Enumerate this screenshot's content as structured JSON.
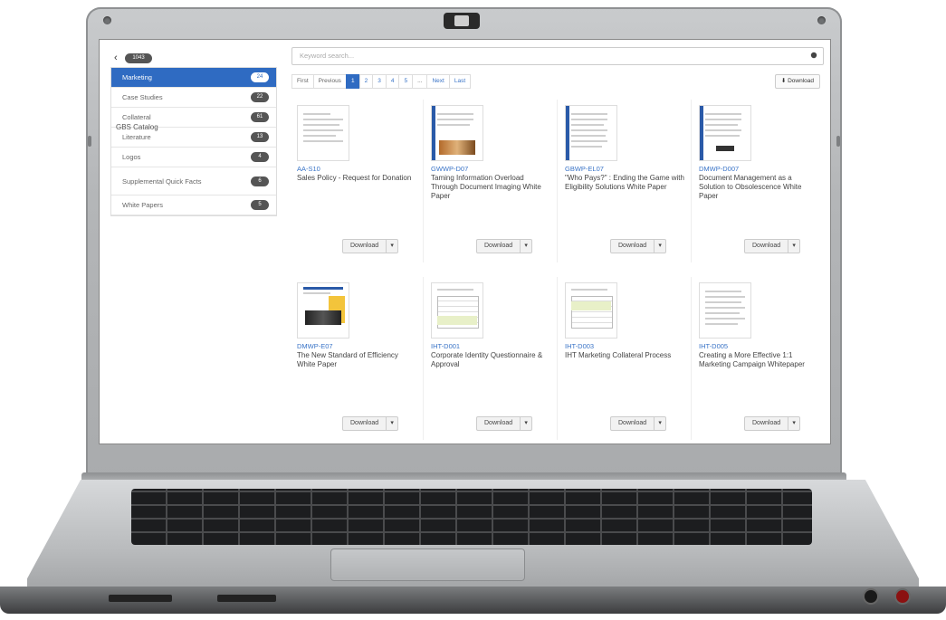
{
  "sidebar": {
    "header": {
      "title": "GBS Catalog",
      "count": "1043"
    },
    "items": [
      {
        "label": "Marketing",
        "count": "24",
        "active": true
      },
      {
        "label": "Case Studies",
        "count": "22",
        "active": false
      },
      {
        "label": "Collateral",
        "count": "61",
        "active": false
      },
      {
        "label": "Literature",
        "count": "13",
        "active": false
      },
      {
        "label": "Logos",
        "count": "4",
        "active": false
      },
      {
        "label": "Supplemental Quick Facts",
        "count": "6",
        "active": false
      },
      {
        "label": "White Papers",
        "count": "5",
        "active": false
      }
    ]
  },
  "search": {
    "placeholder": "Keyword search..."
  },
  "pagination": {
    "first": "First",
    "previous": "Previous",
    "pages": [
      "1",
      "2",
      "3",
      "4",
      "5",
      "..."
    ],
    "next": "Next",
    "last": "Last",
    "current": "1"
  },
  "download_top_label": "Download",
  "cards": [
    {
      "code": "AA-S10",
      "title": "Sales Policy - Request for Donation",
      "button": "Download"
    },
    {
      "code": "GWWP-D07",
      "title": "Taming Information Overload Through Document Imaging White Paper",
      "button": "Download"
    },
    {
      "code": "GBWP-EL07",
      "title": "\"Who Pays?\" : Ending the Game with Eligibility Solutions White Paper",
      "button": "Download"
    },
    {
      "code": "DMWP-D007",
      "title": "Document Management as a Solution to Obsolescence White Paper",
      "button": "Download"
    },
    {
      "code": "DMWP-E07",
      "title": "The New Standard of Efficiency White Paper",
      "button": "Download"
    },
    {
      "code": "IHT-D001",
      "title": "Corporate Identity Questionnaire & Approval",
      "button": "Download"
    },
    {
      "code": "IHT-D003",
      "title": "IHT Marketing Collateral Process",
      "button": "Download"
    },
    {
      "code": "IHT-D005",
      "title": "Creating a More Effective 1:1 Marketing Campaign Whitepaper",
      "button": "Download"
    }
  ],
  "colors": {
    "accent": "#2f6bc2",
    "link": "#3a74c7"
  }
}
